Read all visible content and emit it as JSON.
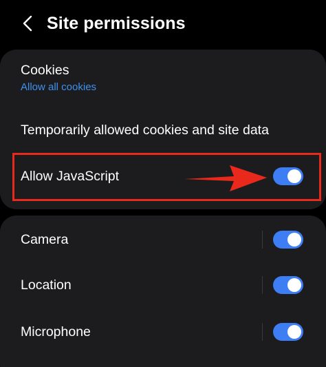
{
  "header": {
    "title": "Site permissions",
    "back_icon": "chevron-left-icon"
  },
  "settings": {
    "cookies": {
      "label": "Cookies",
      "value": "Allow all cookies"
    },
    "temp_cookies": {
      "label": "Temporarily allowed cookies and site data"
    },
    "javascript": {
      "label": "Allow JavaScript",
      "enabled": true
    }
  },
  "permissions": [
    {
      "label": "Camera",
      "enabled": true
    },
    {
      "label": "Location",
      "enabled": true
    },
    {
      "label": "Microphone",
      "enabled": true
    }
  ],
  "colors": {
    "background": "#000000",
    "card": "#1c1c1e",
    "accent": "#3e91f0",
    "toggle_on": "#3e7ef5",
    "annotation": "#e8291c"
  },
  "annotation": {
    "type": "highlight-box-with-arrow",
    "target": "javascript"
  }
}
